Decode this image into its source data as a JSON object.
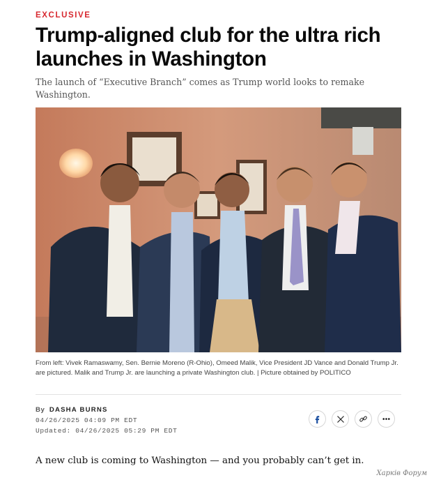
{
  "article": {
    "kicker": "EXCLUSIVE",
    "headline_line1": "Trump-aligned club for the ultra rich",
    "headline_line2": "launches in Washington",
    "dek": "The launch of “Executive Branch” comes as Trump world looks to remake Washington.",
    "caption": "From left: Vivek Ramaswamy, Sen. Bernie Moreno (R-Ohio), Omeed Malik, Vice President JD Vance and Donald Trump Jr. are pictured. Malik and Trump Jr. are launching a private Washington club. | Picture obtained by POLITICO",
    "byline_prefix": "By",
    "author": "DASHA BURNS",
    "published": "04/26/2025 04:09 PM EDT",
    "updated": "Updated: 04/26/2025 05:29 PM EDT",
    "lede": "A new club is coming to Washington — and you probably can’t get in."
  },
  "share_icons": [
    "facebook-icon",
    "x-icon",
    "link-icon",
    "more-icon"
  ],
  "colors": {
    "kicker": "#d7282f",
    "facebook": "#1b4fa0"
  },
  "watermark": "Харків Форум"
}
